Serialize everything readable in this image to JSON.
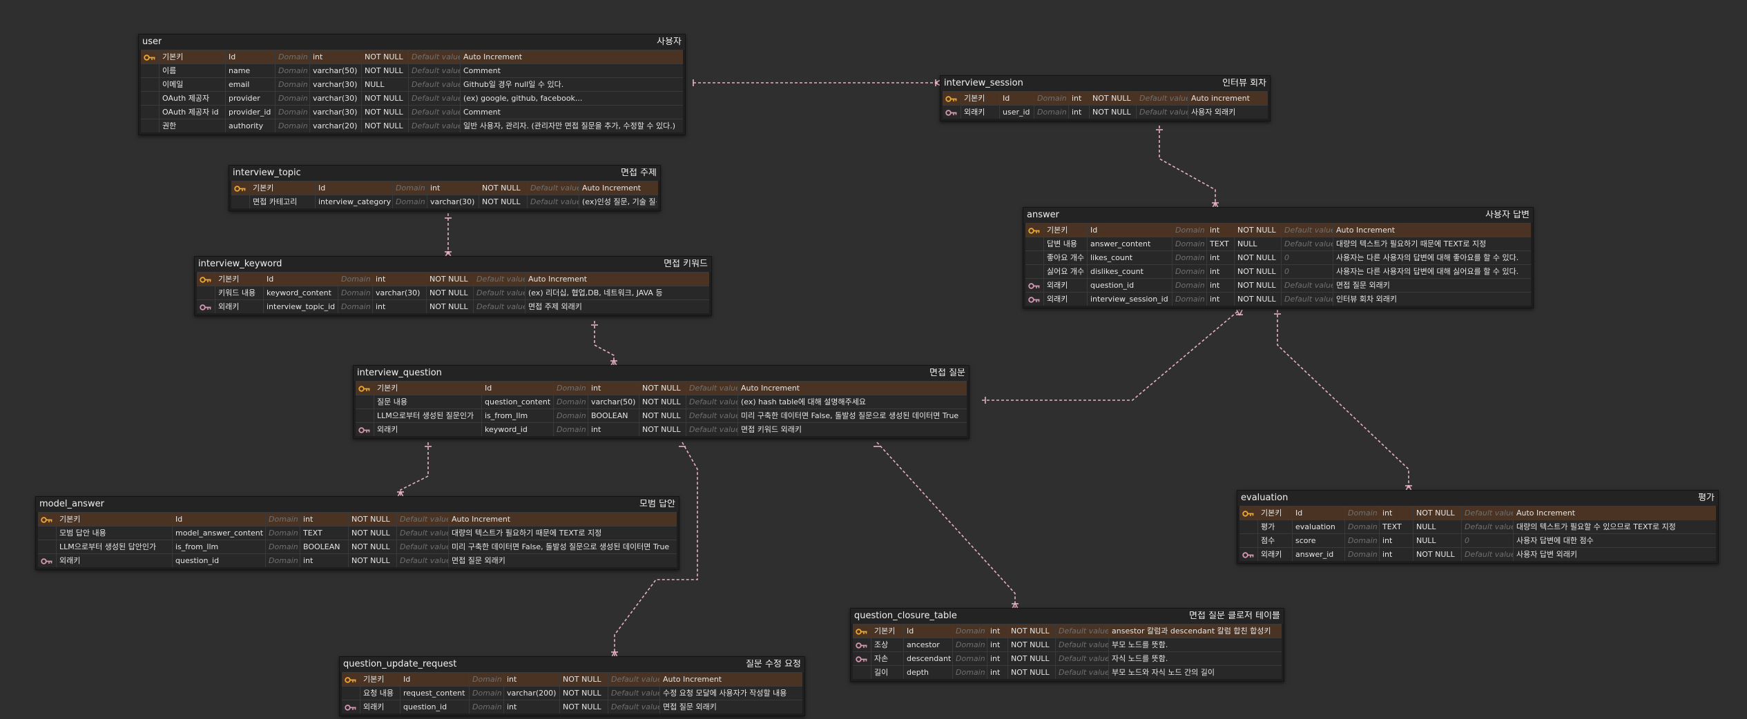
{
  "colors": {
    "background": "#2f2f2f",
    "table": "#1e1e1e",
    "pk_row": "#4a3322",
    "relation_line": "#e8b4c4",
    "pk_icon": "#e8a93a",
    "fk_icon": "#d49ab3"
  },
  "tables": [
    {
      "id": "user",
      "name": "user",
      "comment": "사용자",
      "columns": [
        {
          "key": "pk",
          "logical": "기본키",
          "physical": "Id",
          "domain": "Domain",
          "type": "int",
          "nullable": "NOT NULL",
          "default": "Default value",
          "comment": "Auto Increment"
        },
        {
          "key": "",
          "logical": "이름",
          "physical": "name",
          "domain": "Domain",
          "type": "varchar(50)",
          "nullable": "NOT NULL",
          "default": "Default value",
          "comment": "Comment"
        },
        {
          "key": "",
          "logical": "이메일",
          "physical": "email",
          "domain": "Domain",
          "type": "varchar(30)",
          "nullable": "NULL",
          "default": "Default value",
          "comment": "Github일 경우 null일 수 있다."
        },
        {
          "key": "",
          "logical": "OAuth 제공자",
          "physical": "provider",
          "domain": "Domain",
          "type": "varchar(30)",
          "nullable": "NOT NULL",
          "default": "Default value",
          "comment": "(ex) google, github, facebook..."
        },
        {
          "key": "",
          "logical": "OAuth 제공자 id",
          "physical": "provider_id",
          "domain": "Domain",
          "type": "varchar(30)",
          "nullable": "NOT NULL",
          "default": "Default value",
          "comment": "Comment"
        },
        {
          "key": "",
          "logical": "권한",
          "physical": "authority",
          "domain": "Domain",
          "type": "varchar(20)",
          "nullable": "NOT NULL",
          "default": "Default value",
          "comment": "일반 사용자, 관리자. (관리자만 면접 질문을 추가, 수정할 수 있다.)"
        }
      ]
    },
    {
      "id": "interview_session",
      "name": "interview_session",
      "comment": "인터뷰 회차",
      "columns": [
        {
          "key": "pk",
          "logical": "기본키",
          "physical": "Id",
          "domain": "Domain",
          "type": "int",
          "nullable": "NOT NULL",
          "default": "Default value",
          "comment": "Auto increment"
        },
        {
          "key": "fk",
          "logical": "외래키",
          "physical": "user_id",
          "domain": "Domain",
          "type": "int",
          "nullable": "NOT NULL",
          "default": "Default value",
          "comment": "사용자 외래키"
        }
      ]
    },
    {
      "id": "interview_topic",
      "name": "interview_topic",
      "comment": "면접 주제",
      "columns": [
        {
          "key": "pk",
          "logical": "기본키",
          "physical": "Id",
          "domain": "Domain",
          "type": "int",
          "nullable": "NOT NULL",
          "default": "Default value",
          "comment": "Auto Increment"
        },
        {
          "key": "",
          "logical": "면접 카테고리",
          "physical": "interview_category",
          "domain": "Domain",
          "type": "varchar(30)",
          "nullable": "NOT NULL",
          "default": "Default value",
          "comment": "(ex)인성 질문, 기술 질문"
        }
      ]
    },
    {
      "id": "answer",
      "name": "answer",
      "comment": "사용자 답변",
      "columns": [
        {
          "key": "pk",
          "logical": "기본키",
          "physical": "Id",
          "domain": "Domain",
          "type": "int",
          "nullable": "NOT NULL",
          "default": "Default value",
          "comment": "Auto Increment"
        },
        {
          "key": "",
          "logical": "답변 내용",
          "physical": "answer_content",
          "domain": "Domain",
          "type": "TEXT",
          "nullable": "NULL",
          "default": "Default value",
          "comment": "대량의 텍스트가 필요하기 때문에 TEXT로 지정"
        },
        {
          "key": "",
          "logical": "좋아요 개수",
          "physical": "likes_count",
          "domain": "Domain",
          "type": "int",
          "nullable": "NOT NULL",
          "default": "0",
          "comment": "사용자는 다른 사용자의 답변에 대해 좋아요를 할 수 있다."
        },
        {
          "key": "",
          "logical": "싫어요 개수",
          "physical": "dislikes_count",
          "domain": "Domain",
          "type": "int",
          "nullable": "NOT NULL",
          "default": "0",
          "comment": "사용자는 다른 사용자의 답변에 대해 싫어요를 할 수 있다."
        },
        {
          "key": "fk",
          "logical": "외래키",
          "physical": "question_id",
          "domain": "Domain",
          "type": "int",
          "nullable": "NOT NULL",
          "default": "Default value",
          "comment": "면접 질문 외래키"
        },
        {
          "key": "fk",
          "logical": "외래키",
          "physical": "interview_session_id",
          "domain": "Domain",
          "type": "int",
          "nullable": "NOT NULL",
          "default": "Default value",
          "comment": "인터뷰 회차 외래키"
        }
      ]
    },
    {
      "id": "interview_keyword",
      "name": "interview_keyword",
      "comment": "면접 키워드",
      "columns": [
        {
          "key": "pk",
          "logical": "기본키",
          "physical": "Id",
          "domain": "Domain",
          "type": "int",
          "nullable": "NOT NULL",
          "default": "Default value",
          "comment": "Auto Increment"
        },
        {
          "key": "",
          "logical": "키워드 내용",
          "physical": "keyword_content",
          "domain": "Domain",
          "type": "varchar(30)",
          "nullable": "NOT NULL",
          "default": "Default value",
          "comment": "(ex) 리더십, 협업,DB, 네트워크, JAVA 등"
        },
        {
          "key": "fk",
          "logical": "외래키",
          "physical": "interview_topic_id",
          "domain": "Domain",
          "type": "int",
          "nullable": "NOT NULL",
          "default": "Default value",
          "comment": "면접 주제 외래키"
        }
      ]
    },
    {
      "id": "interview_question",
      "name": "interview_question",
      "comment": "면접 질문",
      "columns": [
        {
          "key": "pk",
          "logical": "기본키",
          "physical": "Id",
          "domain": "Domain",
          "type": "int",
          "nullable": "NOT NULL",
          "default": "Default value",
          "comment": "Auto Increment"
        },
        {
          "key": "",
          "logical": "질문 내용",
          "physical": "question_content",
          "domain": "Domain",
          "type": "varchar(50)",
          "nullable": "NOT NULL",
          "default": "Default value",
          "comment": "(ex) hash table에 대해 설명해주세요"
        },
        {
          "key": "",
          "logical": "LLM으로부터 생성된 질문인가",
          "physical": "is_from_llm",
          "domain": "Domain",
          "type": "BOOLEAN",
          "nullable": "NOT NULL",
          "default": "Default value",
          "comment": "미리 구축한 데이터면 False, 돌발성 질문으로 생성된 데이터면 True"
        },
        {
          "key": "fk",
          "logical": "외래키",
          "physical": "keyword_id",
          "domain": "Domain",
          "type": "int",
          "nullable": "NOT NULL",
          "default": "Default value",
          "comment": "면접 키워드 외래키"
        }
      ]
    },
    {
      "id": "evaluation",
      "name": "evaluation",
      "comment": "평가",
      "columns": [
        {
          "key": "pk",
          "logical": "기본키",
          "physical": "Id",
          "domain": "Domain",
          "type": "int",
          "nullable": "NOT NULL",
          "default": "Default value",
          "comment": "Auto Increment"
        },
        {
          "key": "",
          "logical": "평가",
          "physical": "evaluation",
          "domain": "Domain",
          "type": "TEXT",
          "nullable": "NULL",
          "default": "Default value",
          "comment": "대량의 텍스트가 필요할 수 있으므로 TEXT로 지정"
        },
        {
          "key": "",
          "logical": "점수",
          "physical": "score",
          "domain": "Domain",
          "type": "int",
          "nullable": "NULL",
          "default": "0",
          "comment": "사용자 답변에 대한 점수"
        },
        {
          "key": "fk",
          "logical": "외래키",
          "physical": "answer_id",
          "domain": "Domain",
          "type": "int",
          "nullable": "NOT NULL",
          "default": "Default value",
          "comment": "사용자 답변 외래키"
        }
      ]
    },
    {
      "id": "model_answer",
      "name": "model_answer",
      "comment": "모범 답안",
      "columns": [
        {
          "key": "pk",
          "logical": "기본키",
          "physical": "Id",
          "domain": "Domain",
          "type": "int",
          "nullable": "NOT NULL",
          "default": "Default value",
          "comment": "Auto Increment"
        },
        {
          "key": "",
          "logical": "모범 답안 내용",
          "physical": "model_answer_content",
          "domain": "Domain",
          "type": "TEXT",
          "nullable": "NOT NULL",
          "default": "Default value",
          "comment": "대량의 텍스트가 필요하기 때문에 TEXT로 지정"
        },
        {
          "key": "",
          "logical": "LLM으로부터 생성된 답안인가",
          "physical": "is_from_llm",
          "domain": "Domain",
          "type": "BOOLEAN",
          "nullable": "NOT NULL",
          "default": "Default value",
          "comment": "미리 구축한 데이터면 False, 돌발성 질문으로 생성된 데이터면 True"
        },
        {
          "key": "fk",
          "logical": "외래키",
          "physical": "question_id",
          "domain": "Domain",
          "type": "int",
          "nullable": "NOT NULL",
          "default": "Default value",
          "comment": "면접 질문 외래키"
        }
      ]
    },
    {
      "id": "question_closure_table",
      "name": "question_closure_table",
      "comment": "면접 질문 클로저 테이블",
      "columns": [
        {
          "key": "pk",
          "logical": "기본키",
          "physical": "Id",
          "domain": "Domain",
          "type": "int",
          "nullable": "NOT NULL",
          "default": "Default value",
          "comment": "ansestor 칼럼과 descendant 칼럼 합친 합성키"
        },
        {
          "key": "fk",
          "logical": "조상",
          "physical": "ancestor",
          "domain": "Domain",
          "type": "int",
          "nullable": "NOT NULL",
          "default": "Default value",
          "comment": "부모 노드를 뜻함."
        },
        {
          "key": "fk",
          "logical": "자손",
          "physical": "descendant",
          "domain": "Domain",
          "type": "int",
          "nullable": "NOT NULL",
          "default": "Default value",
          "comment": "자식 노드를 뜻함."
        },
        {
          "key": "",
          "logical": "길이",
          "physical": "depth",
          "domain": "Domain",
          "type": "int",
          "nullable": "NOT NULL",
          "default": "Default value",
          "comment": "부모 노드와 자식 노드 간의 길이"
        }
      ]
    },
    {
      "id": "question_update_request",
      "name": "question_update_request",
      "comment": "질문 수정 요청",
      "columns": [
        {
          "key": "pk",
          "logical": "기본키",
          "physical": "Id",
          "domain": "Domain",
          "type": "int",
          "nullable": "NOT NULL",
          "default": "Default value",
          "comment": "Auto Increment"
        },
        {
          "key": "",
          "logical": "요청 내용",
          "physical": "request_content",
          "domain": "Domain",
          "type": "varchar(200)",
          "nullable": "NOT NULL",
          "default": "Default value",
          "comment": "수정 요청 모달에 사용자가 작성할 내용"
        },
        {
          "key": "fk",
          "logical": "외래키",
          "physical": "question_id",
          "domain": "Domain",
          "type": "int",
          "nullable": "NOT NULL",
          "default": "Default value",
          "comment": "면접 질문 외래키"
        }
      ]
    }
  ]
}
